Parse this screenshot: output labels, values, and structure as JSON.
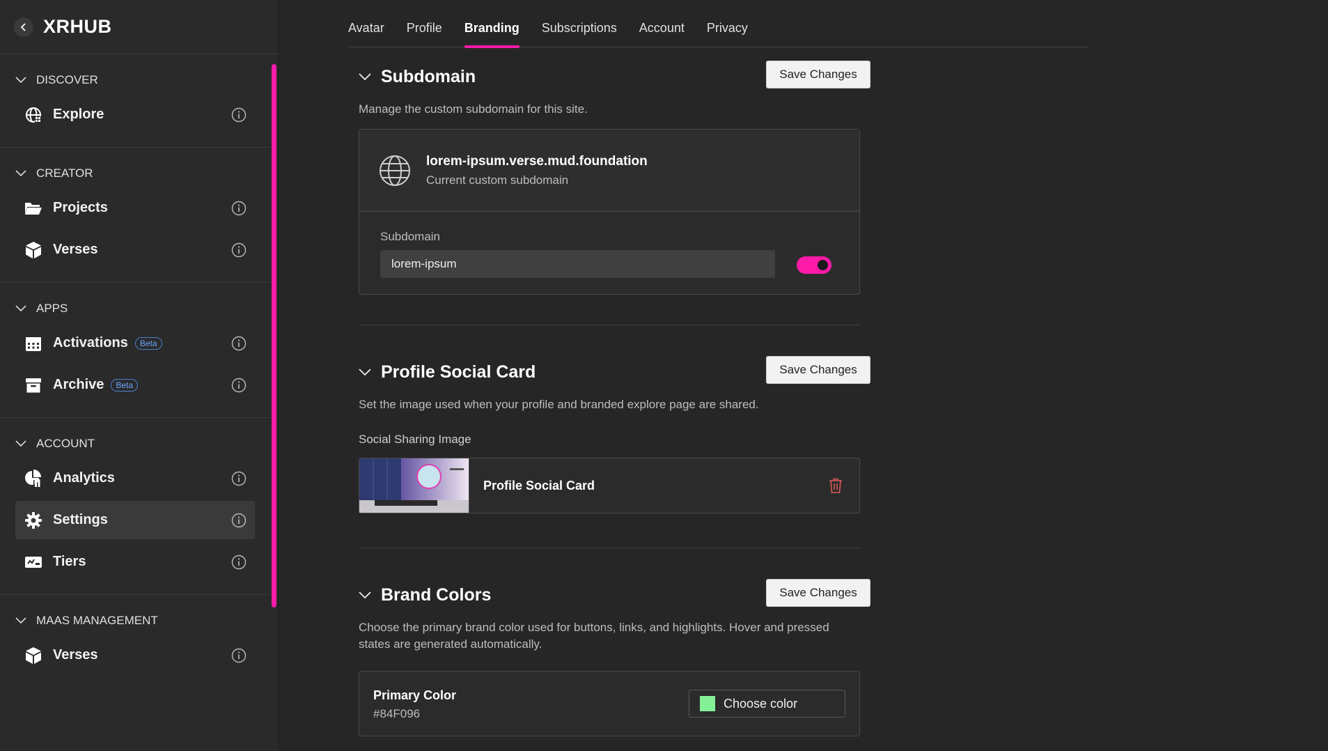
{
  "app": {
    "name": "XRHUB"
  },
  "sidebar": {
    "sections": [
      {
        "title": "DISCOVER",
        "items": [
          {
            "label": "Explore",
            "icon": "globe-grid-icon"
          }
        ]
      },
      {
        "title": "CREATOR",
        "items": [
          {
            "label": "Projects",
            "icon": "folder-icon"
          },
          {
            "label": "Verses",
            "icon": "cube-icon"
          }
        ]
      },
      {
        "title": "APPS",
        "items": [
          {
            "label": "Activations",
            "icon": "calendar-icon",
            "badge": "Beta"
          },
          {
            "label": "Archive",
            "icon": "archive-box-icon",
            "badge": "Beta"
          }
        ]
      },
      {
        "title": "ACCOUNT",
        "items": [
          {
            "label": "Analytics",
            "icon": "chart-pie-icon"
          },
          {
            "label": "Settings",
            "icon": "gear-icon",
            "active": true
          },
          {
            "label": "Tiers",
            "icon": "ticket-icon"
          }
        ]
      },
      {
        "title": "MAAS MANAGEMENT",
        "items": [
          {
            "label": "Verses",
            "icon": "cube-icon"
          }
        ]
      }
    ]
  },
  "tabs": [
    {
      "label": "Avatar"
    },
    {
      "label": "Profile"
    },
    {
      "label": "Branding",
      "active": true
    },
    {
      "label": "Subscriptions"
    },
    {
      "label": "Account"
    },
    {
      "label": "Privacy"
    }
  ],
  "subdomain": {
    "title": "Subdomain",
    "save_label": "Save Changes",
    "description": "Manage the custom subdomain for this site.",
    "current_value": "lorem-ipsum.verse.mud.foundation",
    "current_caption": "Current custom subdomain",
    "field_label": "Subdomain",
    "field_value": "lorem-ipsum",
    "enabled": true
  },
  "social_card": {
    "title": "Profile Social Card",
    "save_label": "Save Changes",
    "description": "Set the image used when your profile and branded explore page are shared.",
    "image_label": "Social Sharing Image",
    "image_name": "Profile Social Card"
  },
  "brand_colors": {
    "title": "Brand Colors",
    "save_label": "Save Changes",
    "description": "Choose the primary brand color used for buttons, links, and highlights. Hover and pressed states are generated automatically.",
    "primary_label": "Primary Color",
    "primary_hex": "#84F096",
    "choose_label": "Choose color"
  },
  "colors": {
    "accent": "#ff1aa8",
    "swatch": "#84F096",
    "danger": "#e05a5a",
    "beta": "#6aa8ff"
  }
}
